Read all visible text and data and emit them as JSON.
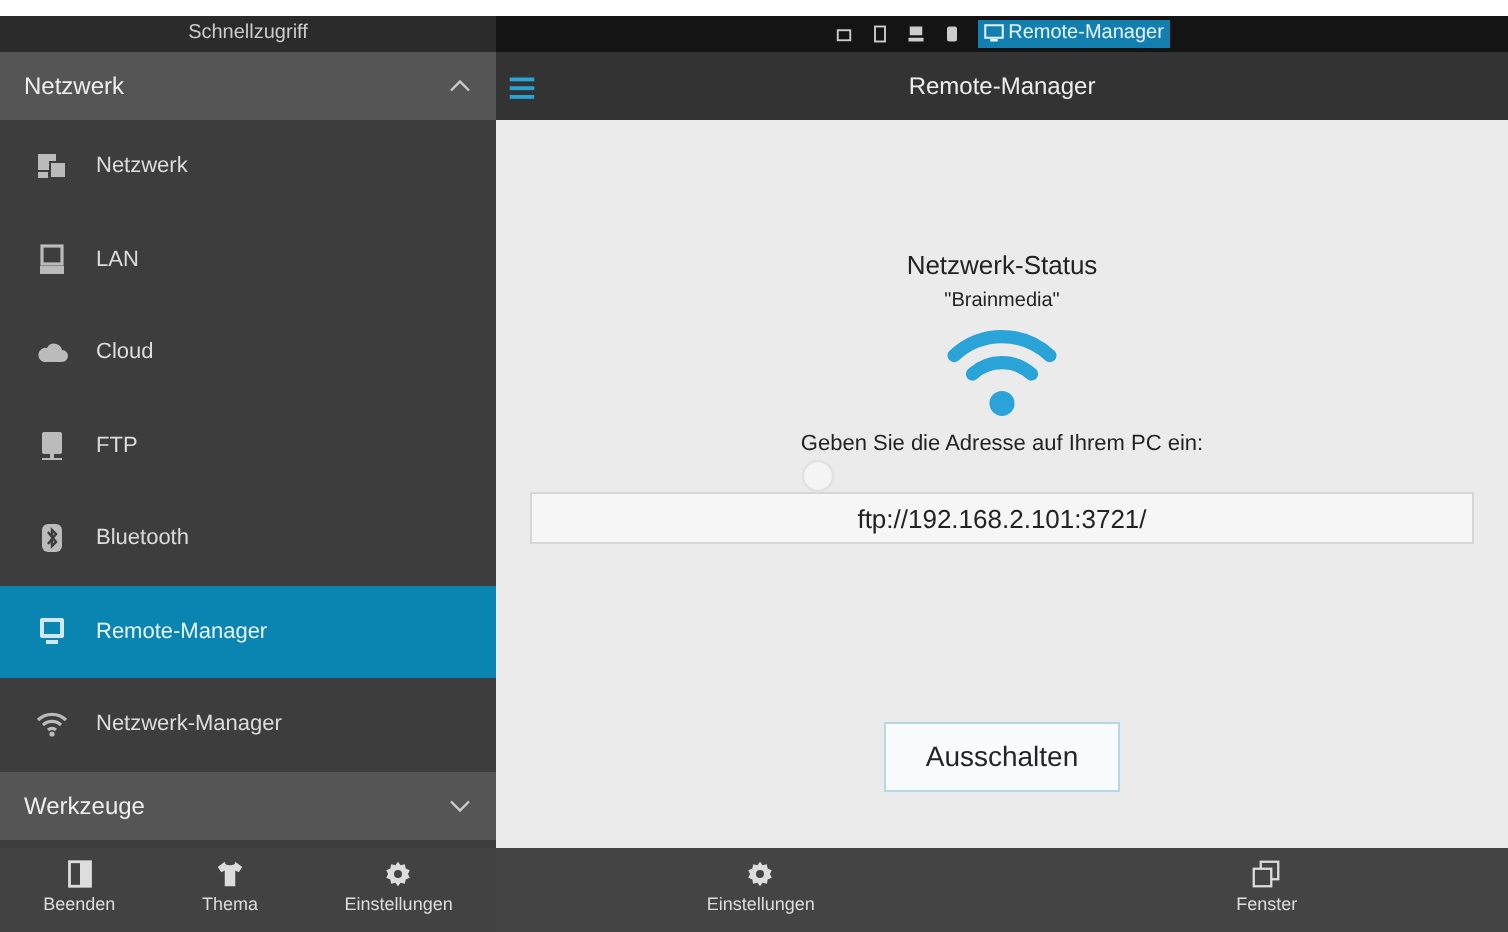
{
  "quick_access": {
    "title": "Schnellzugriff"
  },
  "top_bar": {
    "active_app": {
      "label": "Remote-Manager",
      "selected": true
    }
  },
  "sidebar": {
    "sections": [
      {
        "label": "Netzwerk",
        "expanded": true,
        "items": [
          {
            "label": "Netzwerk",
            "selected": false
          },
          {
            "label": "LAN",
            "selected": false
          },
          {
            "label": "Cloud",
            "selected": false
          },
          {
            "label": "FTP",
            "selected": false
          },
          {
            "label": "Bluetooth",
            "selected": false
          },
          {
            "label": "Remote-Manager",
            "selected": true
          },
          {
            "label": "Netzwerk-Manager",
            "selected": false
          }
        ]
      },
      {
        "label": "Werkzeuge",
        "expanded": false
      }
    ],
    "footer": [
      {
        "label": "Beenden"
      },
      {
        "label": "Thema"
      },
      {
        "label": "Einstellungen"
      }
    ]
  },
  "header": {
    "title": "Remote-Manager"
  },
  "content": {
    "title": "Netzwerk-Status",
    "network": "\"Brainmedia\"",
    "instruction": "Geben Sie die Adresse auf Ihrem PC ein:",
    "address": "ftp://192.168.2.101:3721/",
    "button": "Ausschalten"
  },
  "bottom_bar": [
    {
      "label": "Einstellungen"
    },
    {
      "label": "Fenster"
    }
  ]
}
